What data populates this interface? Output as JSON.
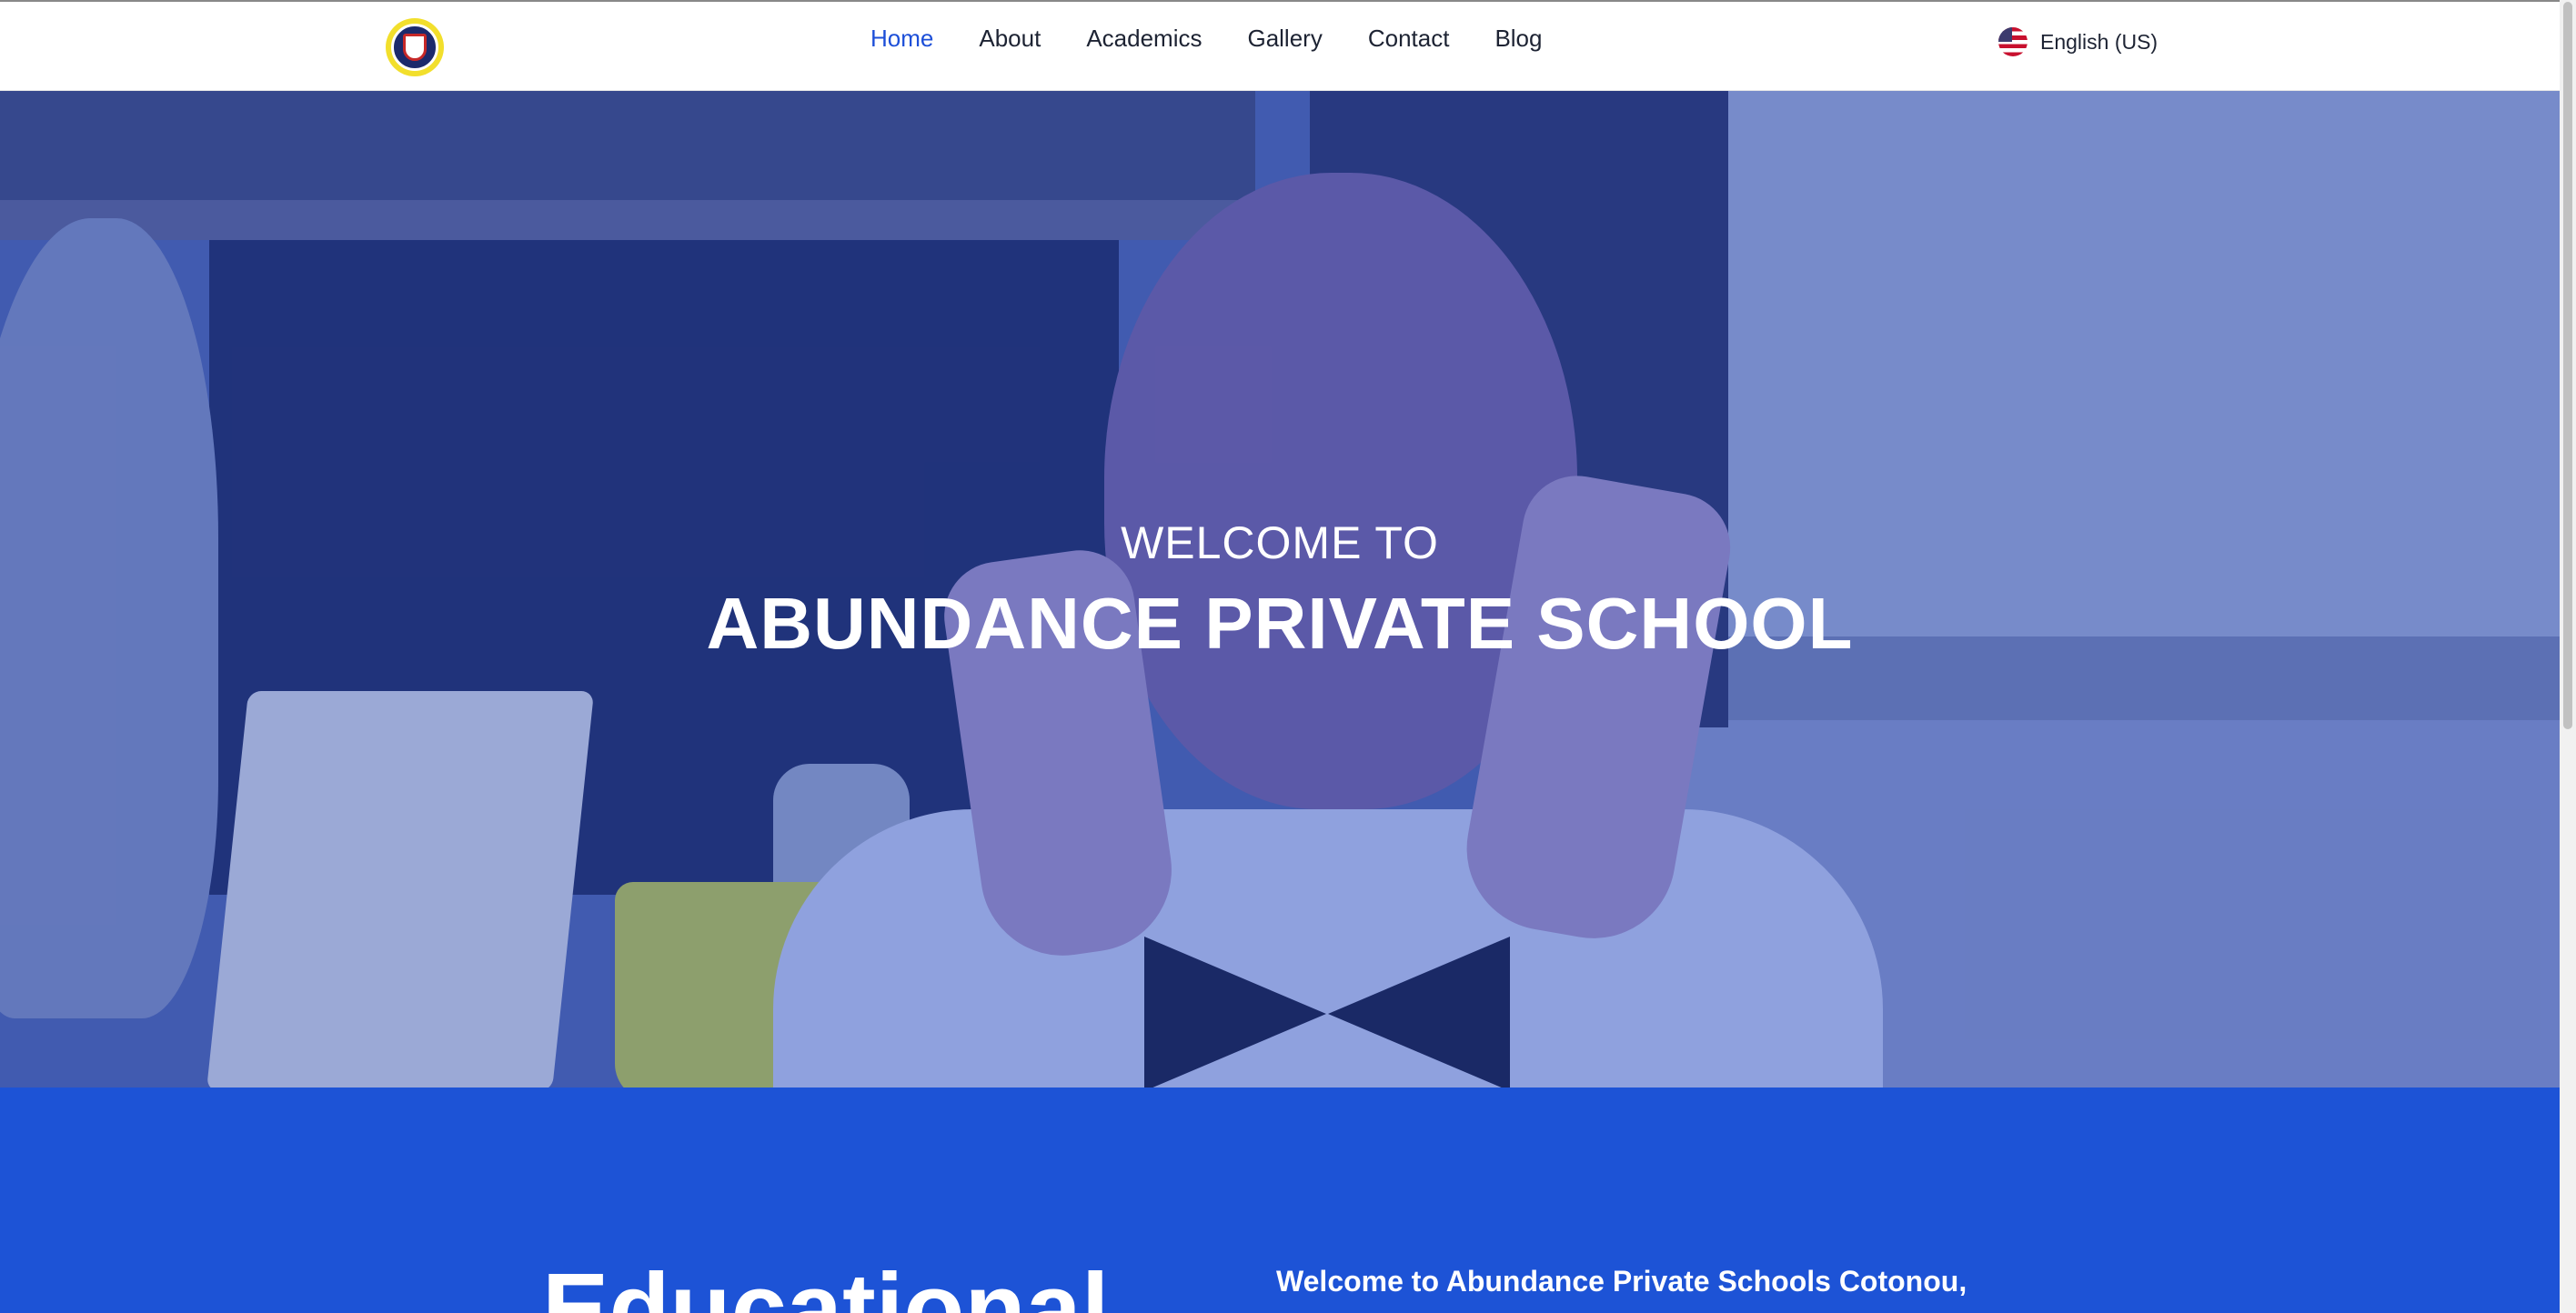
{
  "header": {
    "logo_icon": "school-crest-icon",
    "nav": [
      {
        "label": "Home",
        "active": true
      },
      {
        "label": "About",
        "active": false
      },
      {
        "label": "Academics",
        "active": false
      },
      {
        "label": "Gallery",
        "active": false
      },
      {
        "label": "Contact",
        "active": false
      },
      {
        "label": "Blog",
        "active": false
      }
    ],
    "language": {
      "label": "English (US)",
      "icon": "us-flag-icon"
    }
  },
  "hero": {
    "subtitle": "WELCOME TO",
    "title": "ABUNDANCE PRIVATE SCHOOL"
  },
  "intro": {
    "heading": "Educational",
    "text": "Welcome to Abundance Private Schools Cotonou,"
  },
  "colors": {
    "accent": "#1d4fd8",
    "section_blue": "#1d53d6",
    "text_dark": "#1d2333"
  }
}
